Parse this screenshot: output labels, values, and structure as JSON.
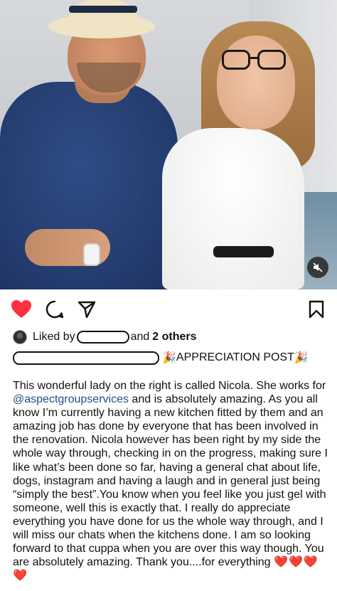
{
  "post": {
    "liked_by_prefix": "Liked by",
    "liked_by_suffix": "and",
    "liked_by_others": "2 others",
    "caption_emoji_left": "🎉",
    "caption_title": "APPRECIATION POST",
    "caption_emoji_right": "🎉",
    "caption_part1": "This wonderful lady on the right is called Nicola. She works for ",
    "caption_mention": "@aspectgroupservices",
    "caption_part2": " and is absolutely amazing. As you all know I’m currently having a new kitchen fitted by them and an amazing job has done by everyone that has been involved in the renovation. Nicola however has been right by my side the whole way through, checking in on the progress, making sure I like what’s been done so far, having a general chat about life, dogs, instagram and having a laugh and in general just being “simply the best”.You know when you feel like you just gel with someone, well this is exactly that. I really do appreciate everything you have done for us the whole way through, and I will miss our chats when the kitchens done. I am so looking forward to that cuppa when you are over this way though. You are absolutely amazing. Thank you....for everything ",
    "caption_hearts": "❤️❤️❤️❤️"
  },
  "icons": {
    "like": "heart-filled-icon",
    "comment": "comment-icon",
    "share": "paper-plane-icon",
    "save": "bookmark-icon",
    "mute": "speaker-muted-icon"
  },
  "colors": {
    "like_red": "#ff3040",
    "mention_blue": "#1f4f8a",
    "text": "#111111"
  }
}
